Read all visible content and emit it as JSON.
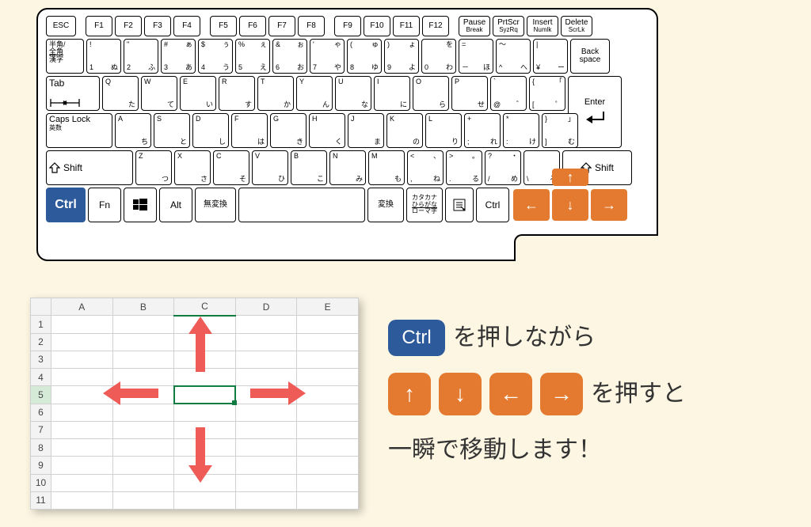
{
  "keyboard": {
    "function_row": [
      "ESC",
      "F1",
      "F2",
      "F3",
      "F4",
      "F5",
      "F6",
      "F7",
      "F8",
      "F9",
      "F10",
      "F11",
      "F12"
    ],
    "fn_extra": [
      {
        "top": "Pause",
        "bottom": "Break"
      },
      {
        "top": "PrtScr",
        "bottom": "SyzRq"
      },
      {
        "top": "Insert",
        "bottom": "Numlk"
      },
      {
        "top": "Delete",
        "bottom": "ScrLk"
      }
    ],
    "row1_left": {
      "l1": "半角/",
      "l2": "全角",
      "l3": "漢字"
    },
    "row1": [
      {
        "tl": "!",
        "tr": "",
        "bl": "1",
        "br": "ぬ"
      },
      {
        "tl": "\"",
        "tr": "",
        "bl": "2",
        "br": "ふ"
      },
      {
        "tl": "#",
        "tr": "ぁ",
        "bl": "3",
        "br": "あ"
      },
      {
        "tl": "$",
        "tr": "ぅ",
        "bl": "4",
        "br": "う"
      },
      {
        "tl": "%",
        "tr": "ぇ",
        "bl": "5",
        "br": "え"
      },
      {
        "tl": "&",
        "tr": "ぉ",
        "bl": "6",
        "br": "お"
      },
      {
        "tl": "'",
        "tr": "ゃ",
        "bl": "7",
        "br": "や"
      },
      {
        "tl": "(",
        "tr": "ゅ",
        "bl": "8",
        "br": "ゆ"
      },
      {
        "tl": ")",
        "tr": "ょ",
        "bl": "9",
        "br": "よ"
      },
      {
        "tl": "",
        "tr": "を",
        "bl": "0",
        "br": "わ"
      },
      {
        "tl": "=",
        "tr": "",
        "bl": "－",
        "br": "ほ"
      },
      {
        "tl": "～",
        "tr": "",
        "bl": "^",
        "br": "へ"
      },
      {
        "tl": "|",
        "tr": "",
        "bl": "¥",
        "br": "ー"
      }
    ],
    "backspace": "Back\nspace",
    "tab": "Tab",
    "row2": [
      {
        "t": "Q",
        "b": "た"
      },
      {
        "t": "W",
        "b": "て"
      },
      {
        "t": "E",
        "b": "い"
      },
      {
        "t": "R",
        "b": "す"
      },
      {
        "t": "T",
        "b": "か"
      },
      {
        "t": "Y",
        "b": "ん"
      },
      {
        "t": "U",
        "b": "な"
      },
      {
        "t": "I",
        "b": "に"
      },
      {
        "t": "O",
        "b": "ら"
      },
      {
        "t": "P",
        "b": "せ"
      },
      {
        "tl": "`",
        "tr": "",
        "bl": "@",
        "br": "゛"
      },
      {
        "tl": "{",
        "tr": "「",
        "bl": "[",
        "br": "゜"
      }
    ],
    "enter": "Enter",
    "caps": {
      "l1": "Caps Lock",
      "l2": "英数"
    },
    "row3": [
      {
        "t": "A",
        "b": "ち"
      },
      {
        "t": "S",
        "b": "と"
      },
      {
        "t": "D",
        "b": "し"
      },
      {
        "t": "F",
        "b": "は"
      },
      {
        "t": "G",
        "b": "き"
      },
      {
        "t": "H",
        "b": "く"
      },
      {
        "t": "J",
        "b": "ま"
      },
      {
        "t": "K",
        "b": "の"
      },
      {
        "t": "L",
        "b": "り"
      },
      {
        "tl": "+",
        "tr": "",
        "bl": ";",
        "br": "れ"
      },
      {
        "tl": "*",
        "tr": "",
        "bl": ":",
        "br": "け"
      },
      {
        "tl": "}",
        "tr": "」",
        "bl": "]",
        "br": "む"
      }
    ],
    "shift": "Shift",
    "row4": [
      {
        "t": "Z",
        "b": "つ"
      },
      {
        "t": "X",
        "b": "さ"
      },
      {
        "t": "C",
        "b": "そ"
      },
      {
        "t": "V",
        "b": "ひ"
      },
      {
        "t": "B",
        "b": "こ"
      },
      {
        "t": "N",
        "b": "み"
      },
      {
        "t": "M",
        "b": "も"
      },
      {
        "tl": "<",
        "tr": "、",
        "bl": ",",
        "br": "ね"
      },
      {
        "tl": ">",
        "tr": "。",
        "bl": ".",
        "br": "る"
      },
      {
        "tl": "?",
        "tr": "・",
        "bl": "/",
        "br": "め"
      },
      {
        "tl": "",
        "tr": "",
        "bl": "\\",
        "br": "ろ"
      }
    ],
    "bottom": {
      "ctrl": "Ctrl",
      "fn": "Fn",
      "alt": "Alt",
      "muhenkan": "無変換",
      "henkan": "変換",
      "kana": {
        "l1": "カタカナ",
        "l2": "ひらがな",
        "l3": "ローマ字"
      },
      "ctrl2": "Ctrl"
    },
    "arrows": {
      "up": "↑",
      "down": "↓",
      "left": "←",
      "right": "→"
    }
  },
  "spreadsheet": {
    "cols": [
      "A",
      "B",
      "C",
      "D",
      "E"
    ],
    "rows": [
      "1",
      "2",
      "3",
      "4",
      "5",
      "6",
      "7",
      "8",
      "9",
      "10",
      "11"
    ],
    "selected": {
      "row": "5",
      "col": "C"
    }
  },
  "instruction": {
    "ctrl_label": "Ctrl",
    "line1_tail": "を押しながら",
    "arrows": [
      "↑",
      "↓",
      "←",
      "→"
    ],
    "line2_tail": "を押すと",
    "line3": "一瞬で移動します！"
  }
}
